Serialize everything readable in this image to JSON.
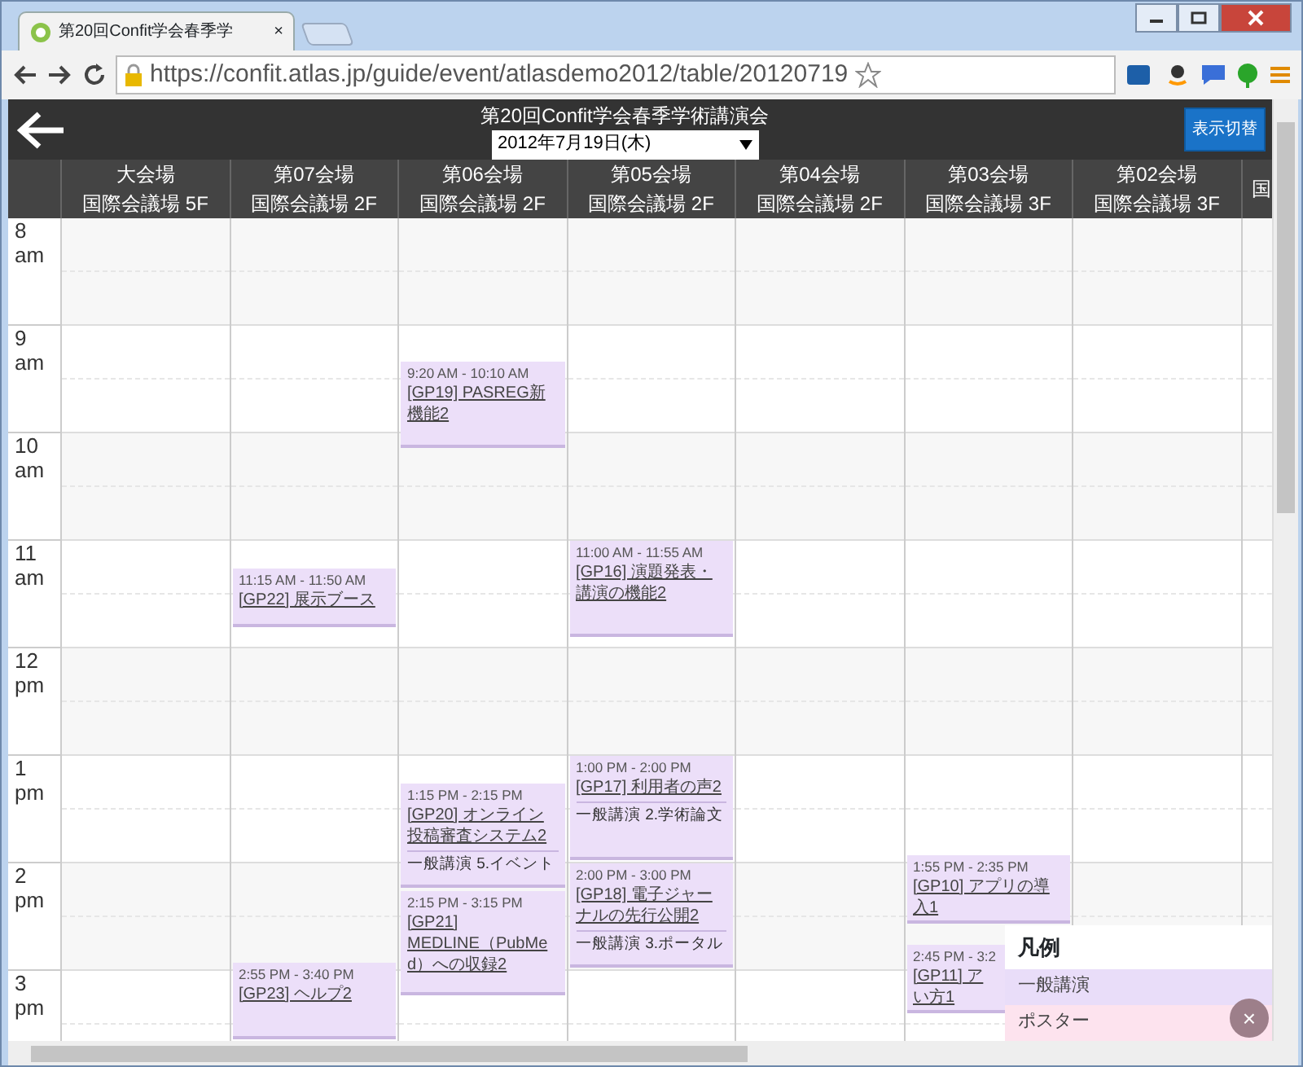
{
  "browser": {
    "tab_title": "第20回Confit学会春季学",
    "tab_close": "×",
    "url": "https://confit.atlas.jp/guide/event/atlasdemo2012/table/20120719"
  },
  "header": {
    "title": "第20回Confit学会春季学術講演会",
    "date_select": "2012年7月19日(木)",
    "toggle_button": "表示切替"
  },
  "columns": [
    {
      "name": "大会場",
      "room": "国際会議場 5F"
    },
    {
      "name": "第07会場",
      "room": "国際会議場 2F",
      "events": [
        {
          "time": "11:15 AM - 11:50 AM",
          "title_lines": [
            "[GP22] 展示ブース"
          ]
        },
        {
          "time": "2:55 PM - 3:40 PM",
          "title_lines": [
            "[GP23] ヘルプ2"
          ]
        }
      ]
    },
    {
      "name": "第06会場",
      "room": "国際会議場 2F",
      "events": [
        {
          "time": "9:20 AM - 10:10 AM",
          "title_lines": [
            "[GP19] PASREG新",
            "機能2"
          ]
        },
        {
          "time": "1:15 PM - 2:15 PM",
          "title_lines": [
            "[GP20] オンライン",
            "投稿審査システム2"
          ],
          "session": "一般講演 5.イベント"
        },
        {
          "time": "2:15 PM - 3:15 PM",
          "title_lines": [
            "[GP21]",
            "MEDLINE（PubMe",
            "d）への収録2"
          ]
        }
      ]
    },
    {
      "name": "第05会場",
      "room": "国際会議場 2F",
      "events": [
        {
          "time": "11:00 AM - 11:55 AM",
          "title_lines": [
            "[GP16] 演題発表・",
            "講演の機能2"
          ]
        },
        {
          "time": "1:00 PM - 2:00 PM",
          "title_lines": [
            "[GP17] 利用者の声2"
          ],
          "session": "一般講演 2.学術論文"
        },
        {
          "time": "2:00 PM - 3:00 PM",
          "title_lines": [
            "[GP18] 電子ジャー",
            "ナルの先行公開2"
          ],
          "session": "一般講演 3.ポータル"
        }
      ]
    },
    {
      "name": "第04会場",
      "room": "国際会議場 2F"
    },
    {
      "name": "第03会場",
      "room": "国際会議場 3F",
      "events": [
        {
          "time": "1:55 PM - 2:35 PM",
          "title_lines": [
            "[GP10] アプリの導",
            "入1"
          ]
        },
        {
          "time": "2:45 PM - 3:2",
          "title_lines": [
            "[GP11] ア",
            "い方1"
          ]
        }
      ]
    },
    {
      "name": "第02会場",
      "room": "国際会議場 3F"
    },
    {
      "room": "国"
    }
  ],
  "hours": [
    {
      "hour": "8",
      "period": "am"
    },
    {
      "hour": "9",
      "period": "am"
    },
    {
      "hour": "10",
      "period": "am"
    },
    {
      "hour": "11",
      "period": "am"
    },
    {
      "hour": "12",
      "period": "pm"
    },
    {
      "hour": "1",
      "period": "pm"
    },
    {
      "hour": "2",
      "period": "pm"
    },
    {
      "hour": "3",
      "period": "pm"
    }
  ],
  "legend": {
    "title": "凡例",
    "items": [
      {
        "label": "一般講演",
        "color": "#e9ddf9"
      },
      {
        "label": "ポスター",
        "color": "#fde3ee"
      }
    ],
    "close": "×"
  }
}
